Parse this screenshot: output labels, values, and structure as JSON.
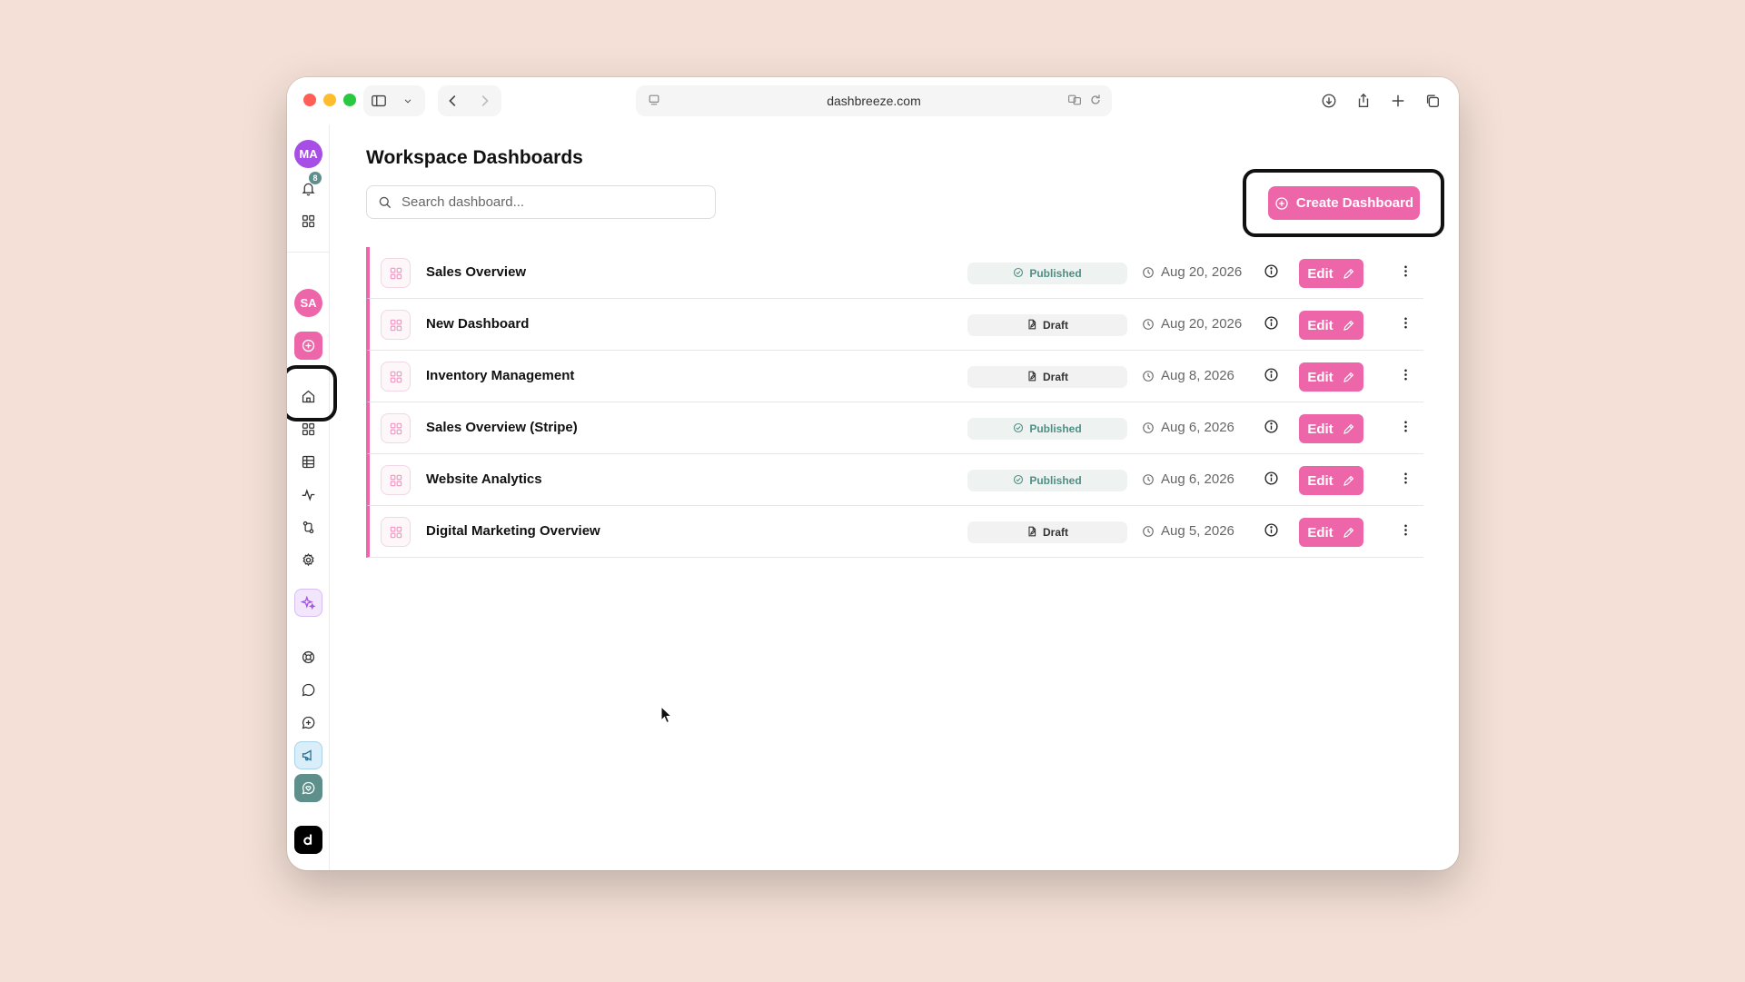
{
  "browser": {
    "url": "dashbreeze.com"
  },
  "sidebar": {
    "user_initials": "MA",
    "user_color": "#a64ee6",
    "notification_count": "8",
    "workspace_initials": "SA",
    "workspace_color": "#ee66aa",
    "items": [
      {
        "name": "home",
        "icon": "home-icon"
      },
      {
        "name": "dashboards",
        "icon": "grid-icon"
      },
      {
        "name": "tables",
        "icon": "table-icon"
      },
      {
        "name": "activity",
        "icon": "activity-icon"
      },
      {
        "name": "data-sources",
        "icon": "connections-icon"
      },
      {
        "name": "settings",
        "icon": "gear-icon"
      }
    ]
  },
  "page": {
    "title": "Workspace Dashboards",
    "search_placeholder": "Search dashboard...",
    "create_label": "Create Dashboard",
    "accent": "#ee66aa"
  },
  "dashboards": [
    {
      "name": "Sales Overview",
      "status": "Published",
      "status_key": "published",
      "date": "Aug 20, 2026",
      "edit_label": "Edit"
    },
    {
      "name": "New Dashboard",
      "status": "Draft",
      "status_key": "draft",
      "date": "Aug 20, 2026",
      "edit_label": "Edit"
    },
    {
      "name": "Inventory Management",
      "status": "Draft",
      "status_key": "draft",
      "date": "Aug 8, 2026",
      "edit_label": "Edit"
    },
    {
      "name": "Sales Overview (Stripe)",
      "status": "Published",
      "status_key": "published",
      "date": "Aug 6, 2026",
      "edit_label": "Edit"
    },
    {
      "name": "Website Analytics",
      "status": "Published",
      "status_key": "published",
      "date": "Aug 6, 2026",
      "edit_label": "Edit"
    },
    {
      "name": "Digital Marketing Overview",
      "status": "Draft",
      "status_key": "draft",
      "date": "Aug 5, 2026",
      "edit_label": "Edit"
    }
  ]
}
